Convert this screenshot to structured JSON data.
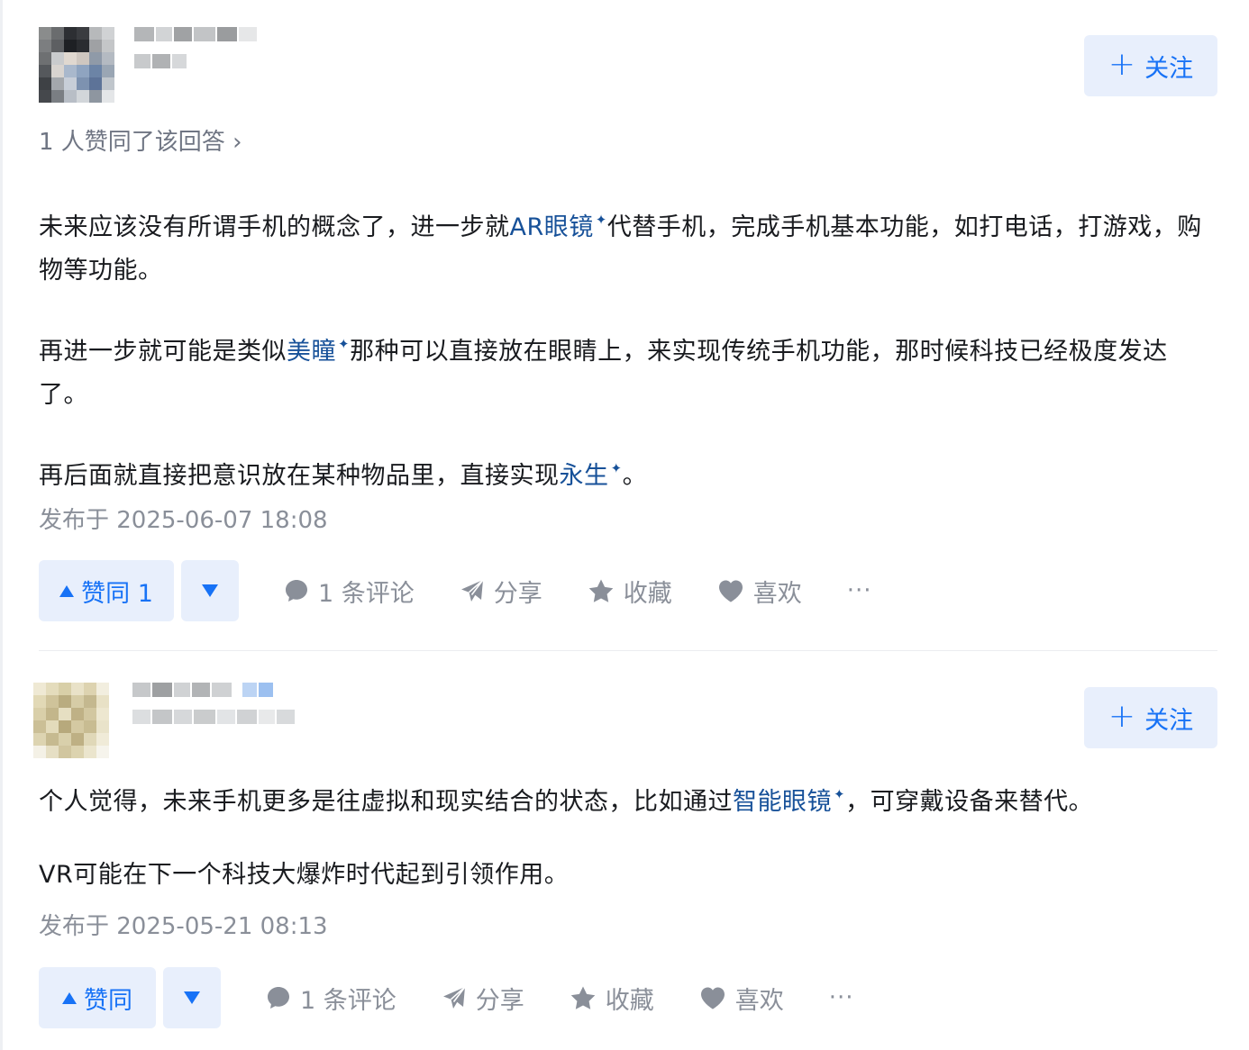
{
  "answers": [
    {
      "follow_label": "关注",
      "upvote_note": "1 人赞同了该回答 ›",
      "para1_a": "未来应该没有所谓手机的概念了，进一步就",
      "para1_link": "AR眼镜",
      "para1_b": "代替手机，完成手机基本功能，如打电话，打游戏，购物等功能。",
      "para2_a": "再进一步就可能是类似",
      "para2_link": "美瞳",
      "para2_b": "那种可以直接放在眼睛上，来实现传统手机功能，那时候科技已经极度发达了。",
      "para3_a": "再后面就直接把意识放在某种物品里，直接实现",
      "para3_link": "永生",
      "para3_b": "。",
      "published": "发布于 2025-06-07 18:08",
      "vote_label": "赞同 1",
      "comment_label": "1 条评论",
      "share_label": "分享",
      "collect_label": "收藏",
      "like_label": "喜欢",
      "more_label": "···"
    },
    {
      "follow_label": "关注",
      "para1_a": "个人觉得，未来手机更多是往虚拟和现实结合的状态，比如通过",
      "para1_link": "智能眼镜",
      "para1_b": "，可穿戴设备来替代。",
      "para2": "VR可能在下一个科技大爆炸时代起到引领作用。",
      "published": "发布于 2025-05-21 08:13",
      "vote_label": "赞同",
      "comment_label": "1 条评论",
      "share_label": "分享",
      "collect_label": "收藏",
      "like_label": "喜欢",
      "more_label": "···"
    }
  ],
  "keyword_star": "✦",
  "colors": {
    "accent": "#1772f6",
    "accent_bg": "#e8effc",
    "link": "#175199",
    "muted": "#8a8f99"
  }
}
